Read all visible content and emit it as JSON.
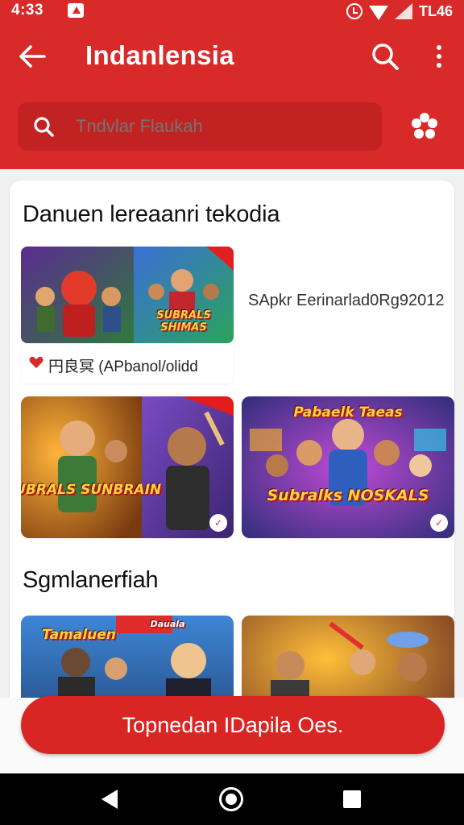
{
  "status": {
    "time": "4:33",
    "right_time": "TL46"
  },
  "appbar": {
    "title": "Indanlensia",
    "search_placeholder": "Tndvlar Flaukah"
  },
  "sections": [
    {
      "title": "Danuen lereaanri tekodia"
    },
    {
      "title": "Sgmlanerfiah"
    }
  ],
  "featured": {
    "meta": "円良冥 (APbanol/olidd",
    "side_text": "SApkr Eerinarlad0Rg92012",
    "caption": "SUBRALS SHIMAS"
  },
  "tiles": [
    {
      "caption": "SUBRALS SUNBRAIN",
      "icon": "game-art"
    },
    {
      "caption": "Subralks NOSKALS",
      "title": "Pabaelk Taeas",
      "icon": "game-art"
    },
    {
      "caption": "Tamaluen",
      "banner": "Dauala",
      "icon": "game-art"
    },
    {
      "caption": "",
      "icon": "game-art"
    }
  ],
  "cta": {
    "label": "Topnedan IDapila Oes."
  },
  "colors": {
    "brand": "#d92a2a",
    "brand_dark": "#c22222",
    "accent": "#ffd43b"
  }
}
